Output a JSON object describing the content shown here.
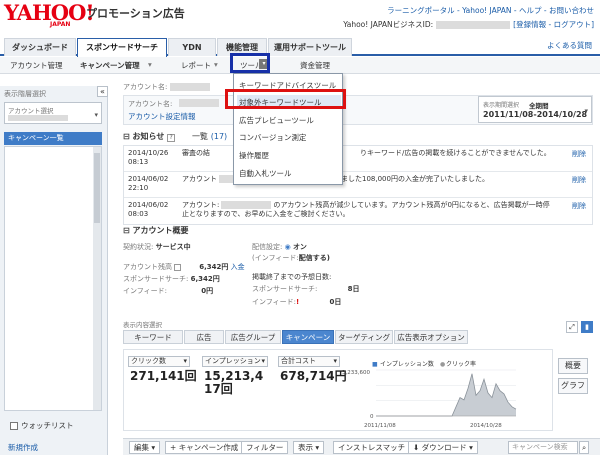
{
  "header": {
    "logo": "YAHOO!",
    "logo_sub": "JAPAN",
    "brand": "プロモーション広告",
    "top_links": "ラーニングポータル - Yahoo! JAPAN - ヘルプ - お問い合わせ",
    "biz_id_label": "Yahoo! JAPANビジネスID:",
    "biz_links": "[登録情報 - ログアウト]",
    "help": "よくある質問"
  },
  "tabs": [
    {
      "label": "ダッシュボード"
    },
    {
      "label": "スポンサードサーチ"
    },
    {
      "label": "YDN"
    },
    {
      "label": "機能管理"
    },
    {
      "label": "運用サポートツール"
    }
  ],
  "subnav": {
    "account": "アカウント管理",
    "campaign": "キャンペーン管理",
    "report": "レポート",
    "tool": "ツール",
    "budget": "資金管理"
  },
  "tool_menu": [
    {
      "label": "キーワードアドバイスツール"
    },
    {
      "label": "対象外キーワードツール"
    },
    {
      "label": "広告プレビューツール"
    },
    {
      "label": "コンバージョン測定"
    },
    {
      "label": "操作履歴"
    },
    {
      "label": "自動入札ツール"
    }
  ],
  "sidebar": {
    "heading": "表示階層選択",
    "account_select": "アカウント選択",
    "campaign_list": "キャンペーン一覧",
    "watchlist": "ウォッチリスト",
    "new_create": "新規作成"
  },
  "account": {
    "name_label": "アカウント名:",
    "name_label2": "アカウント名:",
    "settings": "アカウント設定情報",
    "period_label": "表示期間選択",
    "period_all": "全期間",
    "period_range": "2011/11/08-2014/10/28"
  },
  "notice": {
    "title": "お知らせ",
    "list_link": "一覧",
    "count": "(17)",
    "items": [
      {
        "date": "2014/10/26 08:13",
        "text": "審査の結",
        "text_right": "りキーワード/広告の掲載を続けることができませんでした。",
        "del": "削除"
      },
      {
        "date": "2014/06/02 22:10",
        "text": "アカウント",
        "text_right": "へのお振込みいただきました108,000円の入金が完了いたしました。",
        "del": "削除"
      },
      {
        "date": "2014/06/02 08:03",
        "text": "アカウント:",
        "text_right": "のアカウント残高が減少しています。アカウント残高が0円になると、広告掲載が一時停止となりますので、お早めに入金をご検討ください。",
        "del": "削除"
      }
    ]
  },
  "overview": {
    "title": "アカウント概要",
    "contract_label": "契約状況:",
    "contract_value": "サービス中",
    "balance_label": "アカウント残高",
    "balance_value": "6,342円",
    "deposit_link": "入金",
    "ss_label": "スポンサードサーチ:",
    "ss_value": "6,342円",
    "infeed_label": "インフィード:",
    "infeed_value": "0円",
    "delivery_label": "配信設定:",
    "delivery_value": "オン",
    "infeed_note": "(インフィード:",
    "infeed_note_value": "配信する)",
    "remaining_label": "掲載終了までの予想日数:",
    "remaining_ss_label": "スポンサードサーチ:",
    "remaining_ss_value": "8日",
    "remaining_if_label": "インフィード:",
    "remaining_if_value": "0日"
  },
  "view": {
    "label": "表示内容選択",
    "tabs": [
      {
        "label": "キーワード"
      },
      {
        "label": "広告"
      },
      {
        "label": "広告グループ"
      },
      {
        "label": "キャンペーン"
      },
      {
        "label": "ターゲティング"
      },
      {
        "label": "広告表示オプション"
      }
    ]
  },
  "metrics": [
    {
      "label": "クリック数",
      "value": "271,141回"
    },
    {
      "label": "インプレッション",
      "value": "15,213,417回"
    },
    {
      "label": "合計コスト",
      "value": "678,714円"
    }
  ],
  "chart_data": {
    "type": "area",
    "title": "",
    "legend": [
      "インプレッション数",
      "クリック率"
    ],
    "y_max_label": "3,233,600",
    "y_min_label": "0",
    "x_labels": [
      "2011/11/08",
      "2014/10/28"
    ],
    "series": [
      {
        "name": "インプレッション数",
        "values": [
          0,
          0,
          0,
          0,
          0,
          0,
          0,
          0,
          0,
          0,
          0,
          0,
          0,
          0,
          0,
          0,
          0,
          0,
          0,
          0,
          0.2,
          0.4,
          0.35,
          0.6,
          0.92,
          0.45,
          0.55,
          0.8,
          0.5,
          0.4,
          0.7,
          0.55,
          0.48,
          0.3,
          0.2,
          0.15
        ]
      }
    ],
    "colors": {
      "area": "#c8cdd3",
      "line": "#8a929a"
    }
  },
  "side_buttons": {
    "overview": "概要",
    "graph": "グラフ"
  },
  "bottombar": {
    "edit": "編集",
    "create_campaign": "キャンペーン作成",
    "filter": "フィルター",
    "display": "表示",
    "installsmatch": "インストレスマッチ",
    "download": "ダウンロード",
    "search_placeholder": "キャンペーン検索"
  },
  "colors": {
    "accent": "#2a5ea8",
    "brand_red": "#e60012",
    "selected": "#3f7cc7",
    "highlight_red": "#d11111",
    "highlight_blue": "#1730a8"
  }
}
